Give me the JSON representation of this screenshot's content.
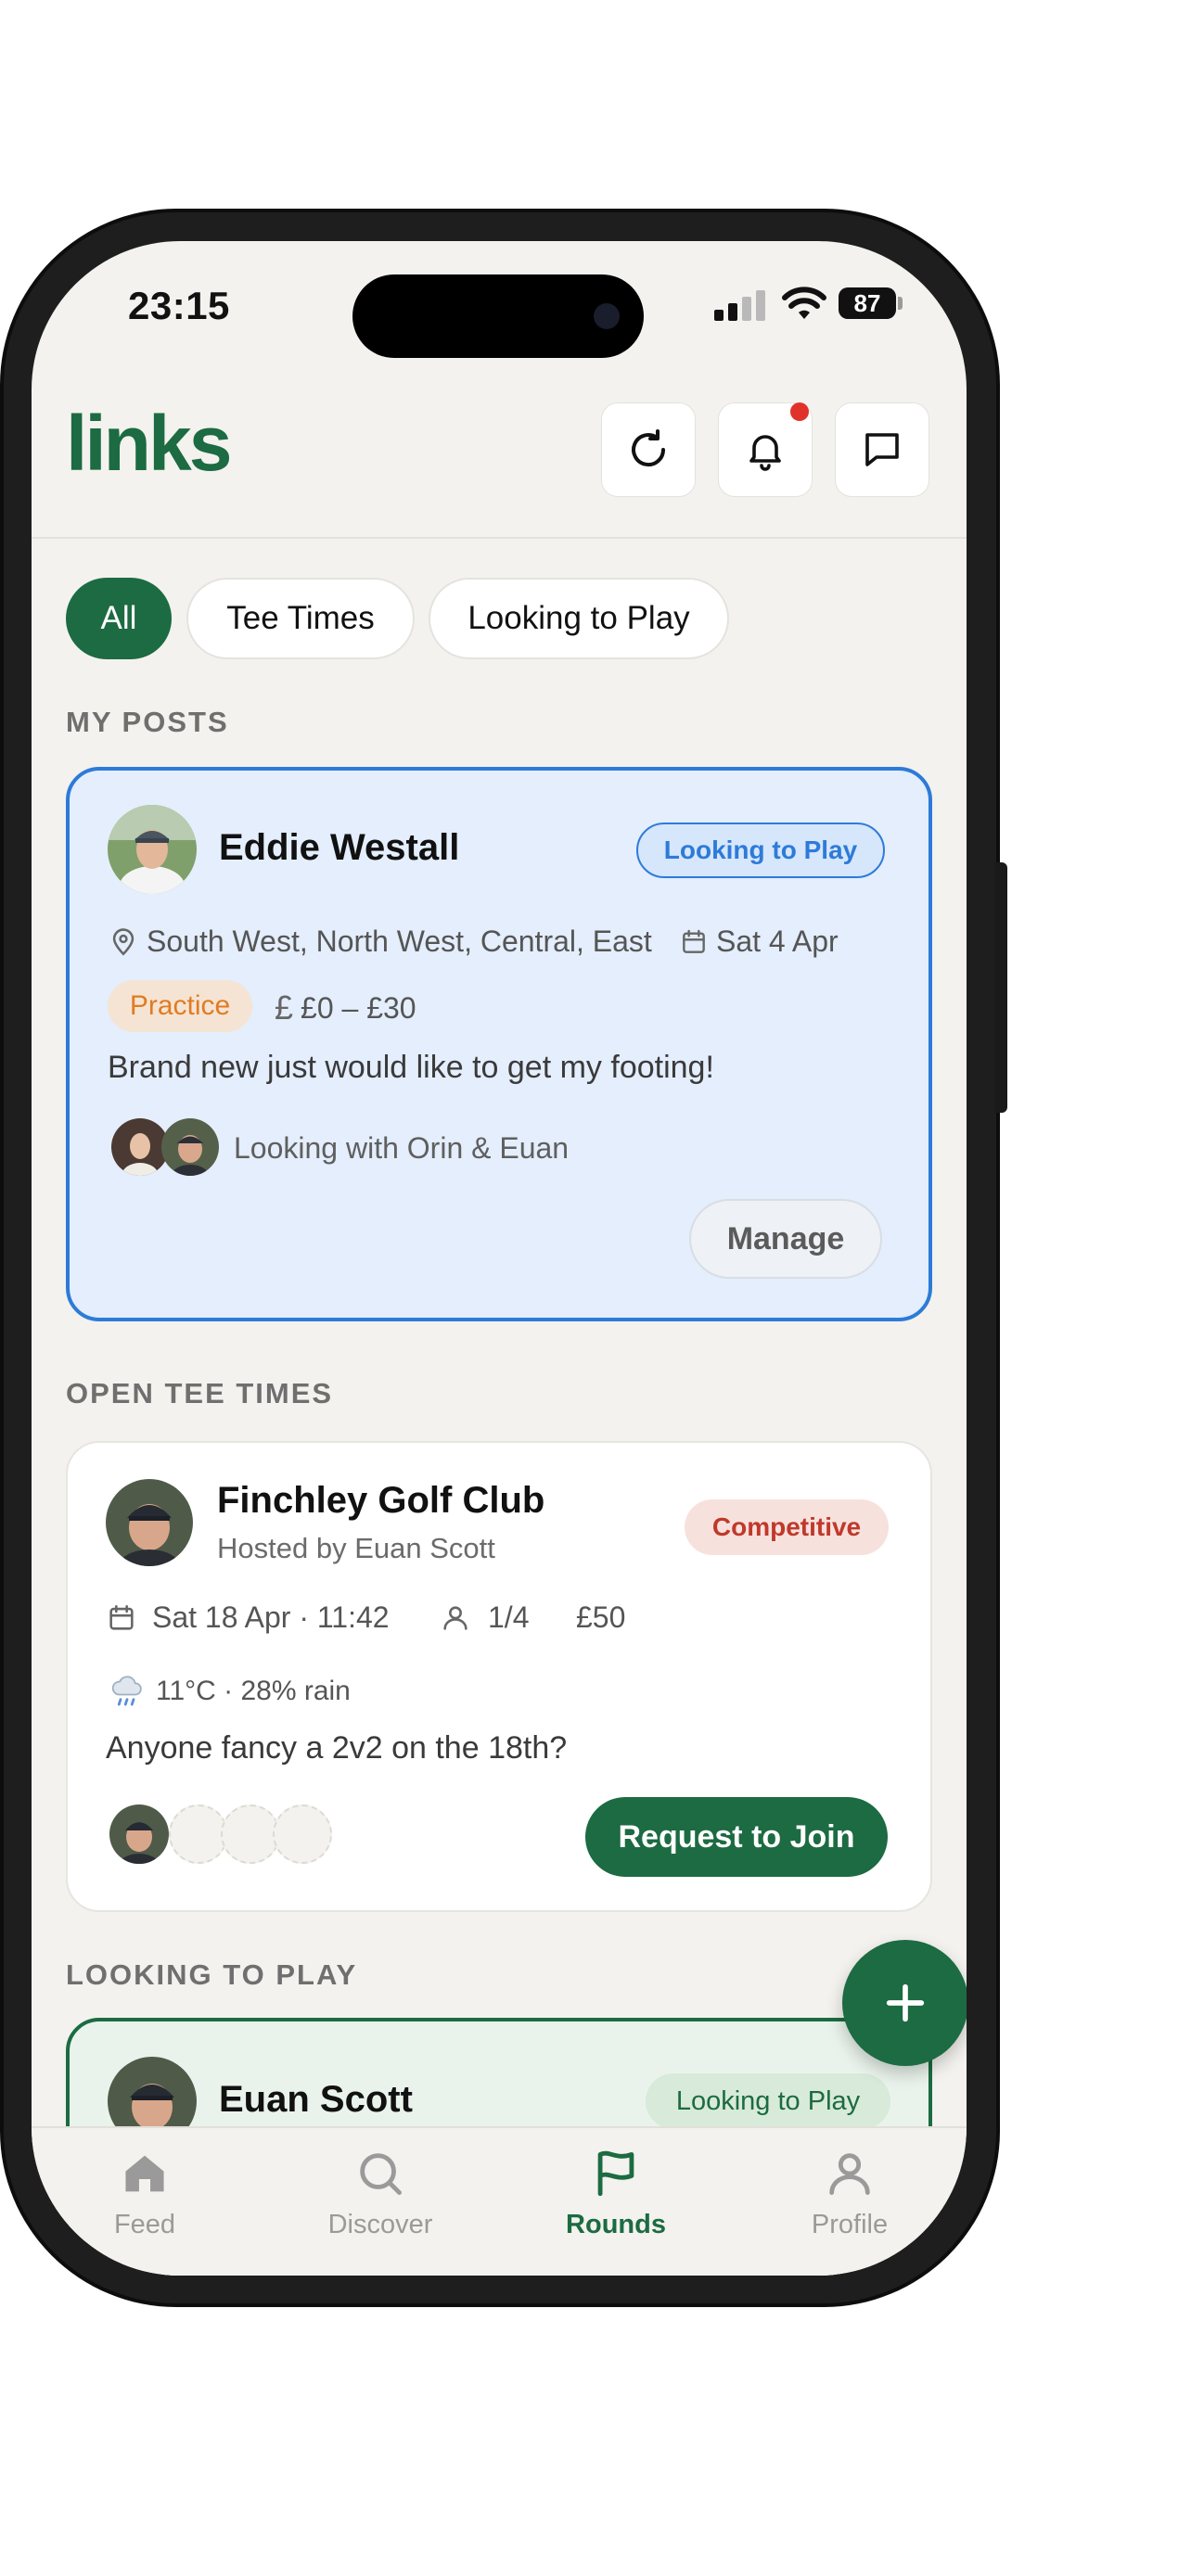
{
  "status_bar": {
    "time": "23:15",
    "battery": "87"
  },
  "header": {
    "logo": "links"
  },
  "filters": [
    {
      "label": "All",
      "active": true
    },
    {
      "label": "Tee Times",
      "active": false
    },
    {
      "label": "Looking to Play",
      "active": false
    }
  ],
  "sections": {
    "my_posts": "MY POSTS",
    "open_tee_times": "OPEN TEE TIMES",
    "looking_to_play": "LOOKING TO PLAY"
  },
  "my_post": {
    "name": "Eddie Westall",
    "badge": "Looking to Play",
    "regions": "South West, North West, Central, East",
    "date": "Sat 4 Apr",
    "tag": "Practice",
    "price": "£0 – £30",
    "message": "Brand new just would like to get my footing!",
    "companions": "Looking with Orin & Euan",
    "manage_label": "Manage"
  },
  "tee_time": {
    "club": "Finchley Golf Club",
    "host": "Hosted by Euan Scott",
    "badge": "Competitive",
    "datetime": "Sat 18 Apr · 11:42",
    "players": "1/4",
    "price": "£50",
    "weather_icon": "rain-cloud-icon",
    "weather": "11°C · 28% rain",
    "message": "Anyone fancy a 2v2 on the 18th?",
    "join_label": "Request to Join"
  },
  "looking_post": {
    "name": "Euan Scott",
    "badge": "Looking to Play"
  },
  "tabs": [
    {
      "label": "Feed",
      "icon": "home-icon",
      "active": false
    },
    {
      "label": "Discover",
      "icon": "search-icon",
      "active": false
    },
    {
      "label": "Rounds",
      "icon": "flag-icon",
      "active": true
    },
    {
      "label": "Profile",
      "icon": "person-icon",
      "active": false
    }
  ],
  "colors": {
    "brand_green": "#1c6b42",
    "my_post_blue": "#2d7bd8",
    "practice_orange": "#e07c22",
    "competitive_red": "#c0392b",
    "notification_red": "#e0322b"
  }
}
